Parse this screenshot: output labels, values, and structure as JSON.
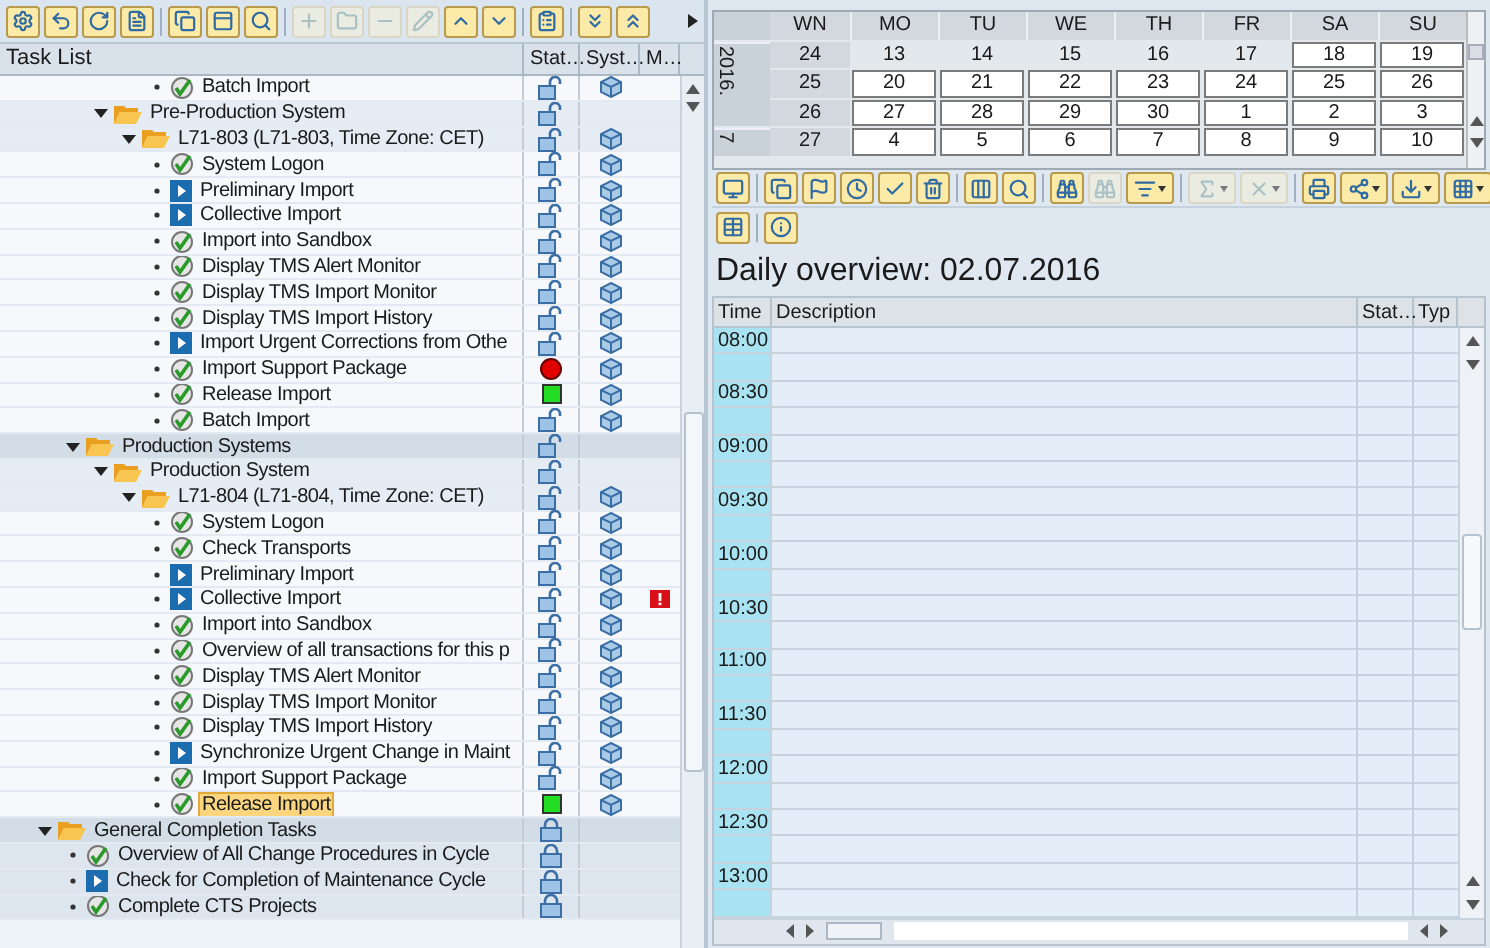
{
  "task_list": {
    "toolbar": [
      {
        "disabled": false
      },
      {
        "disabled": false
      },
      {
        "disabled": false
      },
      {
        "disabled": false
      },
      {
        "disabled": false
      },
      {
        "disabled": false
      },
      {
        "disabled": false
      },
      {
        "disabled": true
      },
      {
        "disabled": true
      },
      {
        "disabled": true
      },
      {
        "disabled": true
      },
      {
        "disabled": false
      },
      {
        "disabled": false
      },
      {
        "disabled": false
      },
      {
        "disabled": false
      },
      {
        "disabled": false
      }
    ],
    "columns": [
      "Task List",
      "Stat…",
      "Syst…",
      "M…"
    ],
    "tree": [
      {
        "kind": "continued",
        "children": [
          {
            "kind": "continued",
            "children": [
              {
                "kind": "continued",
                "children": [
                  {
                    "kind": "continued",
                    "children": [
                      {
                        "kind": "step",
                        "label": "Batch Import",
                        "status": {
                          "kind": "unlocked"
                        },
                        "system": true,
                        "alert": false,
                        "selected": false
                      }
                    ]
                  }
                ]
              },
              {
                "kind": "folder",
                "label": "Pre-Production System",
                "expanded": true,
                "status": {
                  "kind": "unlocked"
                },
                "system": false,
                "alert": false,
                "selected": false,
                "children": [
                  {
                    "kind": "folder",
                    "label": "L71-803 (L71-803, Time Zone: CET)",
                    "expanded": true,
                    "status": {
                      "kind": "unlocked"
                    },
                    "system": true,
                    "alert": false,
                    "selected": false,
                    "children": [
                      {
                        "kind": "step",
                        "label": "System Logon",
                        "status": {
                          "kind": "unlocked"
                        },
                        "system": true,
                        "alert": false,
                        "selected": false
                      },
                      {
                        "kind": "manual",
                        "label": "Preliminary Import",
                        "status": {
                          "kind": "unlocked"
                        },
                        "system": true,
                        "alert": false,
                        "selected": false
                      },
                      {
                        "kind": "manual",
                        "label": "Collective Import",
                        "status": {
                          "kind": "unlocked"
                        },
                        "system": true,
                        "alert": false,
                        "selected": false
                      },
                      {
                        "kind": "step",
                        "label": "Import into Sandbox",
                        "status": {
                          "kind": "unlocked"
                        },
                        "system": true,
                        "alert": false,
                        "selected": false
                      },
                      {
                        "kind": "step",
                        "label": "Display TMS Alert Monitor",
                        "status": {
                          "kind": "unlocked"
                        },
                        "system": true,
                        "alert": false,
                        "selected": false
                      },
                      {
                        "kind": "step",
                        "label": "Display TMS Import Monitor",
                        "status": {
                          "kind": "unlocked"
                        },
                        "system": true,
                        "alert": false,
                        "selected": false
                      },
                      {
                        "kind": "step",
                        "label": "Display TMS Import History",
                        "status": {
                          "kind": "unlocked"
                        },
                        "system": true,
                        "alert": false,
                        "selected": false
                      },
                      {
                        "kind": "manual",
                        "label": "Import Urgent Corrections from Othe",
                        "status": {
                          "kind": "unlocked"
                        },
                        "system": true,
                        "alert": false,
                        "selected": false
                      },
                      {
                        "kind": "step",
                        "label": "Import Support Package",
                        "status": {
                          "kind": "error"
                        },
                        "system": true,
                        "alert": false,
                        "selected": false
                      },
                      {
                        "kind": "step",
                        "label": "Release Import",
                        "status": {
                          "kind": "done"
                        },
                        "system": true,
                        "alert": false,
                        "selected": false
                      },
                      {
                        "kind": "step",
                        "label": "Batch Import",
                        "status": {
                          "kind": "unlocked"
                        },
                        "system": true,
                        "alert": false,
                        "selected": false
                      }
                    ]
                  }
                ]
              }
            ]
          },
          {
            "kind": "folder",
            "label": "Production Systems",
            "expanded": true,
            "status": {
              "kind": "unlocked"
            },
            "system": false,
            "alert": false,
            "selected": false,
            "children": [
              {
                "kind": "folder",
                "label": "Production System",
                "expanded": true,
                "status": {
                  "kind": "unlocked"
                },
                "system": false,
                "alert": false,
                "selected": false,
                "children": [
                  {
                    "kind": "folder",
                    "label": "L71-804 (L71-804, Time Zone: CET)",
                    "expanded": true,
                    "status": {
                      "kind": "unlocked"
                    },
                    "system": true,
                    "alert": false,
                    "selected": false,
                    "children": [
                      {
                        "kind": "step",
                        "label": "System Logon",
                        "status": {
                          "kind": "unlocked"
                        },
                        "system": true,
                        "alert": false,
                        "selected": false
                      },
                      {
                        "kind": "step",
                        "label": "Check Transports",
                        "status": {
                          "kind": "unlocked"
                        },
                        "system": true,
                        "alert": false,
                        "selected": false
                      },
                      {
                        "kind": "manual",
                        "label": "Preliminary Import",
                        "status": {
                          "kind": "unlocked"
                        },
                        "system": true,
                        "alert": false,
                        "selected": false
                      },
                      {
                        "kind": "manual",
                        "label": "Collective Import",
                        "status": {
                          "kind": "unlocked"
                        },
                        "system": true,
                        "alert": true,
                        "selected": false
                      },
                      {
                        "kind": "step",
                        "label": "Import into Sandbox",
                        "status": {
                          "kind": "unlocked"
                        },
                        "system": true,
                        "alert": false,
                        "selected": false
                      },
                      {
                        "kind": "step",
                        "label": "Overview of all transactions for this p",
                        "status": {
                          "kind": "unlocked"
                        },
                        "system": true,
                        "alert": false,
                        "selected": false
                      },
                      {
                        "kind": "step",
                        "label": "Display TMS Alert Monitor",
                        "status": {
                          "kind": "unlocked"
                        },
                        "system": true,
                        "alert": false,
                        "selected": false
                      },
                      {
                        "kind": "step",
                        "label": "Display TMS Import Monitor",
                        "status": {
                          "kind": "unlocked"
                        },
                        "system": true,
                        "alert": false,
                        "selected": false
                      },
                      {
                        "kind": "step",
                        "label": "Display TMS Import History",
                        "status": {
                          "kind": "unlocked"
                        },
                        "system": true,
                        "alert": false,
                        "selected": false
                      },
                      {
                        "kind": "manual",
                        "label": "Synchronize Urgent Change in Maint",
                        "status": {
                          "kind": "unlocked"
                        },
                        "system": true,
                        "alert": false,
                        "selected": false
                      },
                      {
                        "kind": "step",
                        "label": "Import Support Package",
                        "status": {
                          "kind": "unlocked"
                        },
                        "system": true,
                        "alert": false,
                        "selected": false
                      },
                      {
                        "kind": "step",
                        "label": "Release Import",
                        "status": {
                          "kind": "done"
                        },
                        "system": true,
                        "alert": false,
                        "selected": true
                      }
                    ]
                  }
                ]
              }
            ]
          }
        ]
      },
      {
        "kind": "folder",
        "label": "General Completion Tasks",
        "expanded": true,
        "status": {
          "kind": "locked"
        },
        "system": false,
        "alert": false,
        "selected": false,
        "children": [
          {
            "kind": "step",
            "label": "Overview of All Change Procedures in Cycle",
            "status": {
              "kind": "locked"
            },
            "system": false,
            "alert": false,
            "selected": false
          },
          {
            "kind": "manual",
            "label": "Check for Completion of Maintenance Cycle",
            "status": {
              "kind": "locked"
            },
            "system": false,
            "alert": false,
            "selected": false
          },
          {
            "kind": "step",
            "label": "Complete CTS Projects",
            "status": {
              "kind": "locked"
            },
            "system": false,
            "alert": false,
            "selected": false
          }
        ]
      }
    ]
  },
  "calendar": {
    "week_header": "WN",
    "days": [
      "MO",
      "TU",
      "WE",
      "TH",
      "FR",
      "SA",
      "SU"
    ],
    "years": [
      {
        "label": "2016.",
        "weeks": [
          {
            "week": "24",
            "dates": [
              {
                "day": "13",
                "boxed": false
              },
              {
                "day": "14",
                "boxed": false
              },
              {
                "day": "15",
                "boxed": false
              },
              {
                "day": "16",
                "boxed": false
              },
              {
                "day": "17",
                "boxed": false
              },
              {
                "day": "18",
                "boxed": true
              },
              {
                "day": "19",
                "boxed": true
              }
            ]
          },
          {
            "week": "25",
            "dates": [
              {
                "day": "20",
                "boxed": true
              },
              {
                "day": "21",
                "boxed": true
              },
              {
                "day": "22",
                "boxed": true
              },
              {
                "day": "23",
                "boxed": true
              },
              {
                "day": "24",
                "boxed": true
              },
              {
                "day": "25",
                "boxed": true
              },
              {
                "day": "26",
                "boxed": true
              }
            ]
          },
          {
            "week": "26",
            "dates": [
              {
                "day": "27",
                "boxed": true
              },
              {
                "day": "28",
                "boxed": true
              },
              {
                "day": "29",
                "boxed": true
              },
              {
                "day": "30",
                "boxed": true
              },
              {
                "day": "1",
                "boxed": true
              },
              {
                "day": "2",
                "boxed": true
              },
              {
                "day": "3",
                "boxed": true
              }
            ]
          }
        ]
      },
      {
        "label": "7",
        "weeks": [
          {
            "week": "27",
            "dates": [
              {
                "day": "4",
                "boxed": true
              },
              {
                "day": "5",
                "boxed": true
              },
              {
                "day": "6",
                "boxed": true
              },
              {
                "day": "7",
                "boxed": true
              },
              {
                "day": "8",
                "boxed": true
              },
              {
                "day": "9",
                "boxed": true
              },
              {
                "day": "10",
                "boxed": true
              }
            ]
          }
        ]
      }
    ],
    "toolbar": [
      {
        "disabled": false
      },
      {
        "disabled": false
      },
      {
        "disabled": false
      },
      {
        "disabled": false
      },
      {
        "disabled": false
      },
      {
        "disabled": false
      },
      {
        "disabled": false
      },
      {
        "disabled": false
      },
      {
        "disabled": false
      },
      {
        "disabled": true
      },
      {
        "disabled": false
      },
      {
        "disabled": true
      },
      {
        "disabled": true
      },
      {
        "disabled": false
      },
      {
        "disabled": false
      },
      {
        "disabled": false
      },
      {
        "disabled": false
      }
    ],
    "toolbar_2": [
      {
        "disabled": false
      },
      {
        "disabled": false
      }
    ]
  },
  "daily": {
    "title": "Daily overview: 02.07.2016",
    "columns": [
      "Time",
      "Description",
      "Stat…",
      "Typ"
    ],
    "times": [
      "08:00",
      "08:30",
      "09:00",
      "09:30",
      "10:00",
      "10:30",
      "11:00",
      "11:30",
      "12:00",
      "12:30",
      "13:00"
    ]
  }
}
